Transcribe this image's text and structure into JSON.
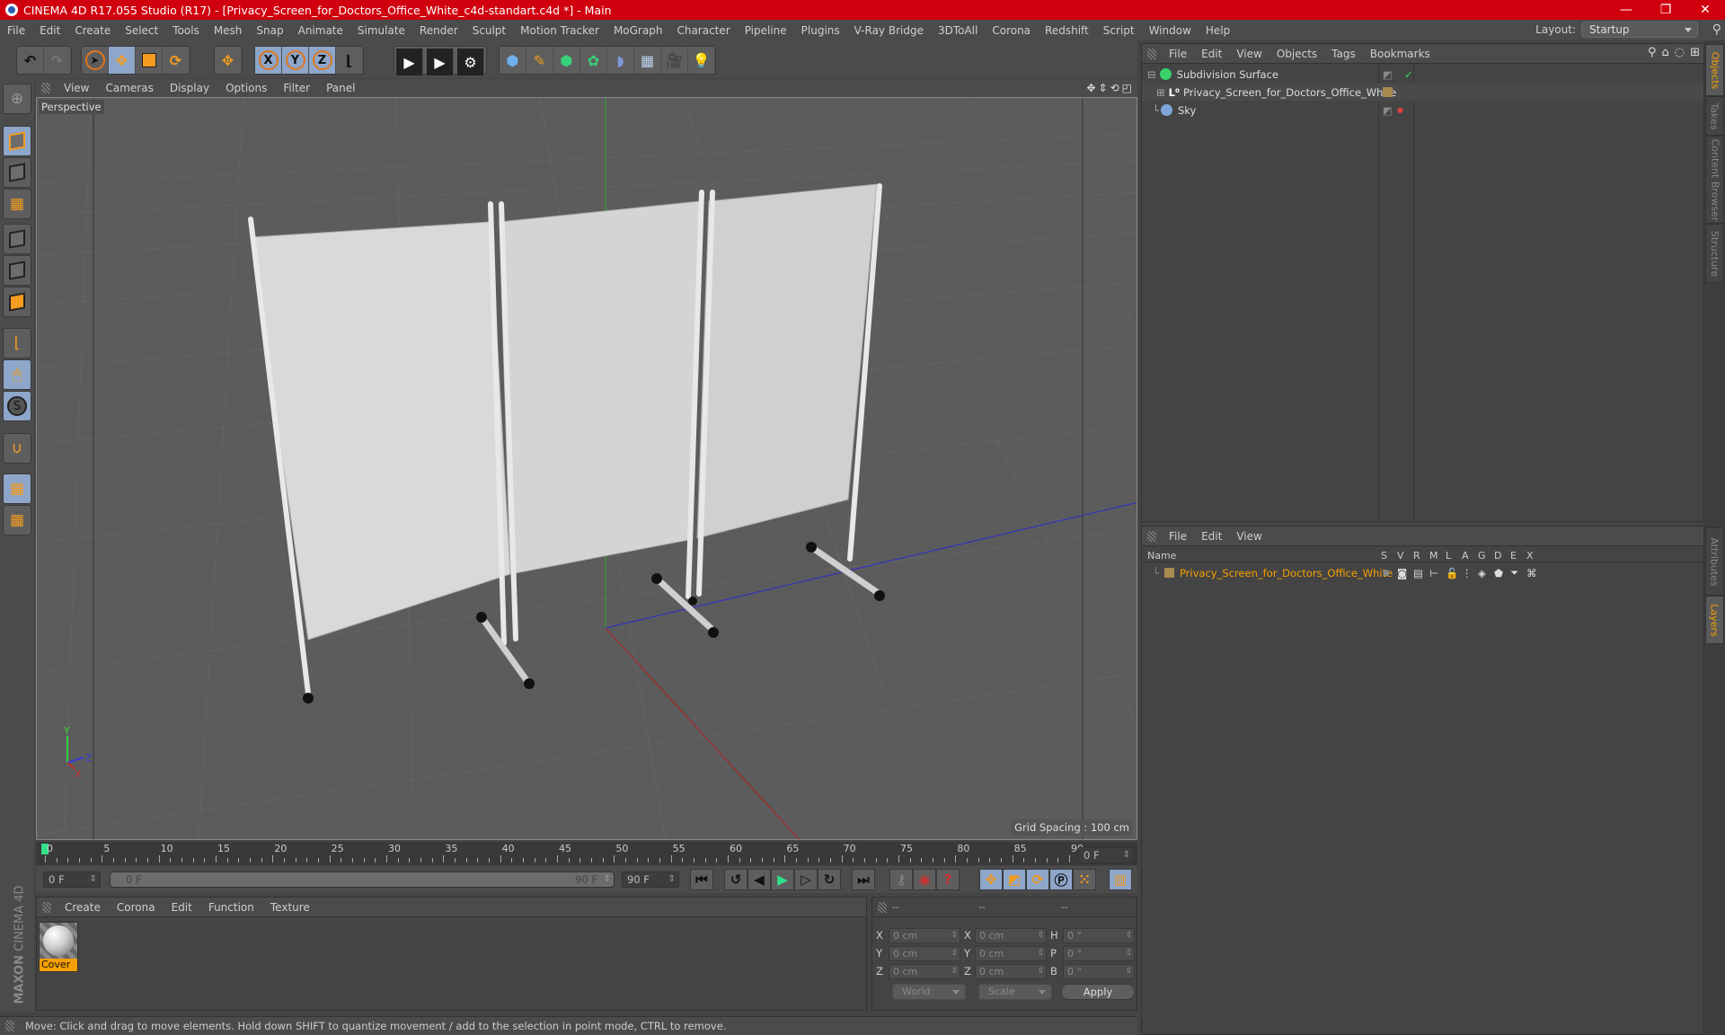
{
  "window": {
    "title": "CINEMA 4D R17.055 Studio (R17) - [Privacy_Screen_for_Doctors_Office_White_c4d-standart.c4d *] - Main",
    "controls": {
      "minimize": "—",
      "maximize": "❐",
      "close": "✕"
    }
  },
  "menubar": {
    "items": [
      "File",
      "Edit",
      "Create",
      "Select",
      "Tools",
      "Mesh",
      "Snap",
      "Animate",
      "Simulate",
      "Render",
      "Sculpt",
      "Motion Tracker",
      "MoGraph",
      "Character",
      "Pipeline",
      "Plugins",
      "V-Ray Bridge",
      "3DToAll",
      "Corona",
      "Redshift",
      "Script",
      "Window",
      "Help"
    ],
    "layout_label": "Layout:",
    "layout_value": "Startup"
  },
  "toolbar": {
    "groups": [
      [
        "undo-icon",
        "redo-icon"
      ],
      [
        "live-selection-icon",
        "move-icon",
        "scale-icon",
        "rotate-icon"
      ],
      [
        "last-tool-icon"
      ],
      [
        "x-axis-icon",
        "y-axis-icon",
        "z-axis-icon",
        "coordinate-system-icon"
      ],
      [
        "render-view-icon",
        "render-picture-viewer-icon",
        "render-settings-icon"
      ],
      [
        "cube-icon",
        "pen-icon",
        "subdivision-icon",
        "cloner-icon",
        "deformer-icon",
        "floor-icon",
        "camera-icon",
        "light-icon"
      ]
    ],
    "axis_labels": [
      "X",
      "Y",
      "Z"
    ]
  },
  "left_tools": [
    "make-editable-icon",
    "model-mode-icon",
    "texture-mode-icon",
    "workplane-icon",
    "points-mode-icon",
    "edges-mode-icon",
    "polygons-mode-icon",
    "axis-mode-icon",
    "tweak-mode-icon",
    "solo-icon",
    "snap-icon",
    "workplane-lock-icon",
    "workplane-align-icon"
  ],
  "viewport": {
    "menu": [
      "View",
      "Cameras",
      "Display",
      "Options",
      "Filter",
      "Panel"
    ],
    "label": "Perspective",
    "grid_spacing": "Grid Spacing : 100 cm",
    "axis": {
      "x": "X",
      "y": "Y",
      "z": "Z"
    }
  },
  "timeline": {
    "ticks": [
      "0",
      "5",
      "10",
      "15",
      "20",
      "25",
      "30",
      "35",
      "40",
      "45",
      "50",
      "55",
      "60",
      "65",
      "70",
      "75",
      "80",
      "85",
      "90"
    ],
    "current_frame_field": "0 F",
    "start_field": "0 F",
    "range_start": "0 F",
    "range_end": "90 F",
    "end_field": "90 F",
    "right_frame_field": "0 F"
  },
  "materials": {
    "menu": [
      "Create",
      "Corona",
      "Edit",
      "Function",
      "Texture"
    ],
    "items": [
      {
        "name": "Cover"
      }
    ]
  },
  "coordinates": {
    "headers": [
      "--",
      "--",
      "--"
    ],
    "rows": [
      {
        "l1": "X",
        "v1": "0 cm",
        "l2": "X",
        "v2": "0 cm",
        "l3": "H",
        "v3": "0 °"
      },
      {
        "l1": "Y",
        "v1": "0 cm",
        "l2": "Y",
        "v2": "0 cm",
        "l3": "P",
        "v3": "0 °"
      },
      {
        "l1": "Z",
        "v1": "0 cm",
        "l2": "Z",
        "v2": "0 cm",
        "l3": "B",
        "v3": "0 °"
      }
    ],
    "mode": "World",
    "type": "Scale",
    "apply": "Apply"
  },
  "object_manager": {
    "menu": [
      "File",
      "Edit",
      "View",
      "Objects",
      "Tags",
      "Bookmarks"
    ],
    "objects": [
      {
        "name": "Subdivision Surface",
        "color": "#3ad06a"
      },
      {
        "name": "Privacy_Screen_for_Doctors_Office_White",
        "color": "#a8894f"
      },
      {
        "name": "Sky",
        "color": "#7fa6d8"
      }
    ]
  },
  "layer_manager": {
    "menu": [
      "File",
      "Edit",
      "View"
    ],
    "columns": [
      "Name",
      "S",
      "V",
      "R",
      "M",
      "L",
      "A",
      "G",
      "D",
      "E",
      "X"
    ],
    "layers": [
      {
        "name": "Privacy_Screen_for_Doctors_Office_White",
        "color": "#a8894f"
      }
    ]
  },
  "right_tabs": [
    "Objects",
    "Takes",
    "Content Browser",
    "Structure",
    "Attributes",
    "Layers"
  ],
  "brand": {
    "line1": "MAXON",
    "line2": "CINEMA 4D"
  },
  "status": "Move: Click and drag to move elements. Hold down SHIFT to quantize movement / add to the selection in point mode, CTRL to remove.",
  "colors": {
    "title_bar": "#d0000f",
    "accent": "#f5a000",
    "active_tool": "#8da6c9",
    "layer_text": "#f5a000"
  }
}
